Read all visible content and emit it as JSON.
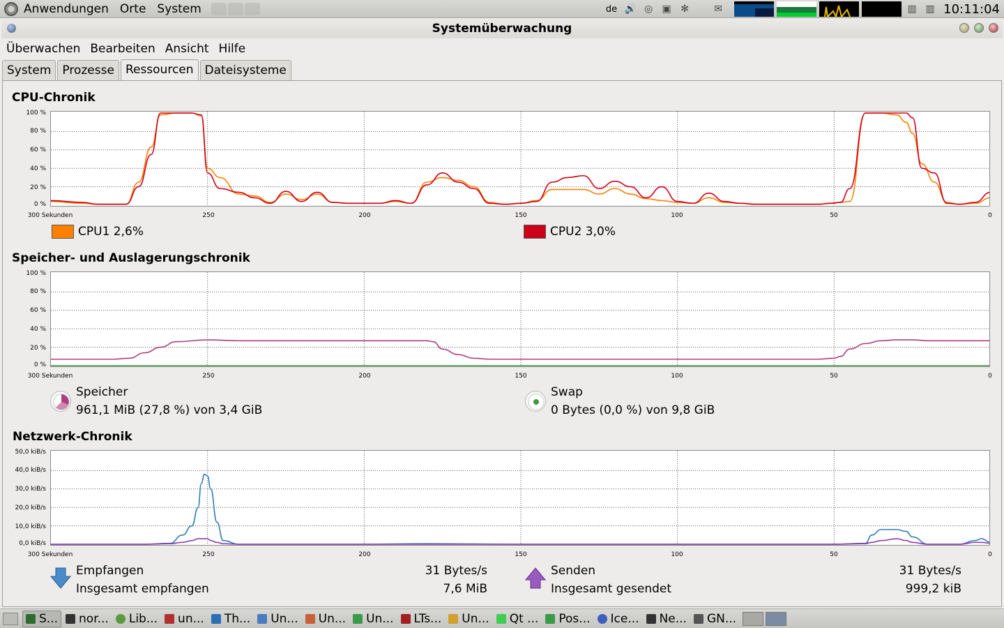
{
  "top_panel": {
    "menus": [
      "Anwendungen",
      "Orte",
      "System"
    ],
    "keyboard": "de",
    "clock": "10:11:04"
  },
  "window": {
    "title": "Systemüberwachung"
  },
  "menubar": [
    "Überwachen",
    "Bearbeiten",
    "Ansicht",
    "Hilfe"
  ],
  "tabs": [
    "System",
    "Prozesse",
    "Ressourcen",
    "Dateisysteme"
  ],
  "active_tab": "Ressourcen",
  "cpu": {
    "title": "CPU-Chronik",
    "ylabels": [
      "100 %",
      "80 %",
      "60 %",
      "40 %",
      "20 %",
      "0 %"
    ],
    "xlabels": [
      "300 Sekunden",
      "250",
      "200",
      "150",
      "100",
      "50",
      "0"
    ],
    "cpu1_label": "CPU1 2,6%",
    "cpu2_label": "CPU2 3,0%",
    "cpu1_color": "#ff7f00",
    "cpu2_color": "#cc0019"
  },
  "memory": {
    "title": "Speicher- und Auslagerungschronik",
    "ylabels": [
      "100 %",
      "80 %",
      "60 %",
      "40 %",
      "20 %",
      "0 %"
    ],
    "xlabels": [
      "300 Sekunden",
      "250",
      "200",
      "150",
      "100",
      "50",
      "0"
    ],
    "mem_label": "Speicher",
    "mem_value": "961,1 MiB (27,8 %) von 3,4 GiB",
    "swap_label": "Swap",
    "swap_value": "0 Bytes (0,0 %) von 9,8 GiB",
    "mem_color": "#ad3f7a",
    "swap_color": "#3e9a3a"
  },
  "network": {
    "title": "Netzwerk-Chronik",
    "ylabels": [
      "50,0 kiB/s",
      "40,0 kiB/s",
      "30,0 kiB/s",
      "20,0 kiB/s",
      "10,0 kiB/s",
      "0,0 kiB/s"
    ],
    "xlabels": [
      "300 Sekunden",
      "250",
      "200",
      "150",
      "100",
      "50",
      "0"
    ],
    "recv_label": "Empfangen",
    "recv_total_label": "Insgesamt empfangen",
    "recv_rate": "31 Bytes/s",
    "recv_total": "7,6 MiB",
    "send_label": "Senden",
    "send_total_label": "Insgesamt gesendet",
    "send_rate": "31 Bytes/s",
    "send_total": "999,2 kiB",
    "recv_color": "#2d7db3",
    "send_color": "#8f3aa8"
  },
  "chart_data": [
    {
      "type": "line",
      "title": "CPU-Chronik",
      "x_unit": "seconds ago",
      "ylim": [
        0,
        100
      ],
      "x": [
        300,
        290,
        285,
        280,
        276,
        272,
        268,
        265,
        260,
        255,
        252,
        250,
        246,
        240,
        235,
        230,
        225,
        220,
        215,
        210,
        205,
        200,
        195,
        190,
        185,
        180,
        175,
        170,
        165,
        160,
        155,
        150,
        145,
        140,
        135,
        130,
        125,
        120,
        115,
        110,
        105,
        100,
        95,
        90,
        85,
        80,
        75,
        70,
        65,
        60,
        55,
        51,
        48,
        45,
        40,
        35,
        30,
        27,
        25,
        22,
        18,
        14,
        10,
        5,
        0
      ],
      "series": [
        {
          "name": "CPU1",
          "values": [
            4,
            2,
            1,
            1,
            1,
            25,
            63,
            98,
            100,
            100,
            97,
            40,
            30,
            12,
            10,
            3,
            12,
            6,
            12,
            3,
            2,
            2,
            2,
            4,
            2,
            25,
            30,
            27,
            20,
            3,
            1,
            2,
            5,
            17,
            17,
            17,
            12,
            18,
            12,
            7,
            5,
            3,
            2,
            8,
            3,
            2,
            1,
            1,
            1,
            1,
            1,
            2,
            3,
            4,
            100,
            100,
            98,
            90,
            78,
            45,
            25,
            3,
            1,
            2,
            8
          ]
        },
        {
          "name": "CPU2",
          "values": [
            5,
            3,
            1,
            1,
            1,
            20,
            55,
            100,
            100,
            100,
            98,
            35,
            18,
            14,
            8,
            2,
            15,
            4,
            14,
            3,
            2,
            2,
            2,
            5,
            2,
            22,
            35,
            25,
            18,
            2,
            1,
            2,
            4,
            25,
            30,
            32,
            18,
            26,
            20,
            8,
            20,
            4,
            2,
            13,
            4,
            2,
            1,
            1,
            1,
            1,
            1,
            2,
            3,
            18,
            100,
            100,
            100,
            100,
            95,
            40,
            35,
            2,
            1,
            3,
            14
          ]
        }
      ]
    },
    {
      "type": "line",
      "title": "Speicher- und Auslagerungschronik",
      "x_unit": "seconds ago",
      "ylim": [
        0,
        100
      ],
      "x": [
        300,
        290,
        280,
        275,
        270,
        265,
        260,
        250,
        240,
        230,
        220,
        210,
        200,
        190,
        185,
        180,
        178,
        175,
        170,
        165,
        160,
        150,
        140,
        130,
        120,
        110,
        100,
        90,
        80,
        70,
        60,
        55,
        50,
        48,
        45,
        40,
        35,
        30,
        25,
        20,
        10,
        0
      ],
      "series": [
        {
          "name": "Speicher",
          "values": [
            7,
            7,
            7,
            8,
            14,
            20,
            26,
            28,
            27,
            27,
            27,
            27,
            27,
            27,
            27,
            27,
            26,
            18,
            12,
            8,
            7,
            7,
            7,
            7,
            7,
            7,
            7,
            7,
            7,
            7,
            7,
            7,
            8,
            10,
            18,
            24,
            27,
            28,
            28,
            27,
            27,
            27
          ]
        },
        {
          "name": "Swap",
          "values": [
            0,
            0,
            0,
            0,
            0,
            0,
            0,
            0,
            0,
            0,
            0,
            0,
            0,
            0,
            0,
            0,
            0,
            0,
            0,
            0,
            0,
            0,
            0,
            0,
            0,
            0,
            0,
            0,
            0,
            0,
            0,
            0,
            0,
            0,
            0,
            0,
            0,
            0,
            0,
            0,
            0,
            0
          ]
        }
      ]
    },
    {
      "type": "line",
      "title": "Netzwerk-Chronik",
      "x_unit": "seconds ago",
      "ylim": [
        0,
        50
      ],
      "x": [
        300,
        280,
        270,
        262,
        258,
        255,
        253,
        252,
        251,
        250,
        249,
        247,
        245,
        240,
        230,
        200,
        180,
        150,
        100,
        50,
        40,
        38,
        35,
        30,
        27,
        25,
        20,
        10,
        5,
        3,
        0
      ],
      "series": [
        {
          "name": "Empfangen",
          "values": [
            0,
            0,
            0,
            0.5,
            5,
            10,
            20,
            33,
            38,
            37,
            30,
            12,
            2,
            0,
            0,
            0,
            0.3,
            0,
            0,
            0,
            0.5,
            5,
            8,
            8,
            7,
            4,
            0,
            0,
            2,
            3,
            1
          ]
        },
        {
          "name": "Senden",
          "values": [
            0,
            0,
            0,
            0.3,
            1,
            2,
            3,
            3,
            3,
            3,
            2,
            1,
            0.3,
            0,
            0,
            0,
            0,
            0,
            0,
            0,
            0.3,
            1,
            2,
            3,
            2,
            1,
            0,
            0,
            1,
            1,
            0.5
          ]
        }
      ]
    }
  ]
}
